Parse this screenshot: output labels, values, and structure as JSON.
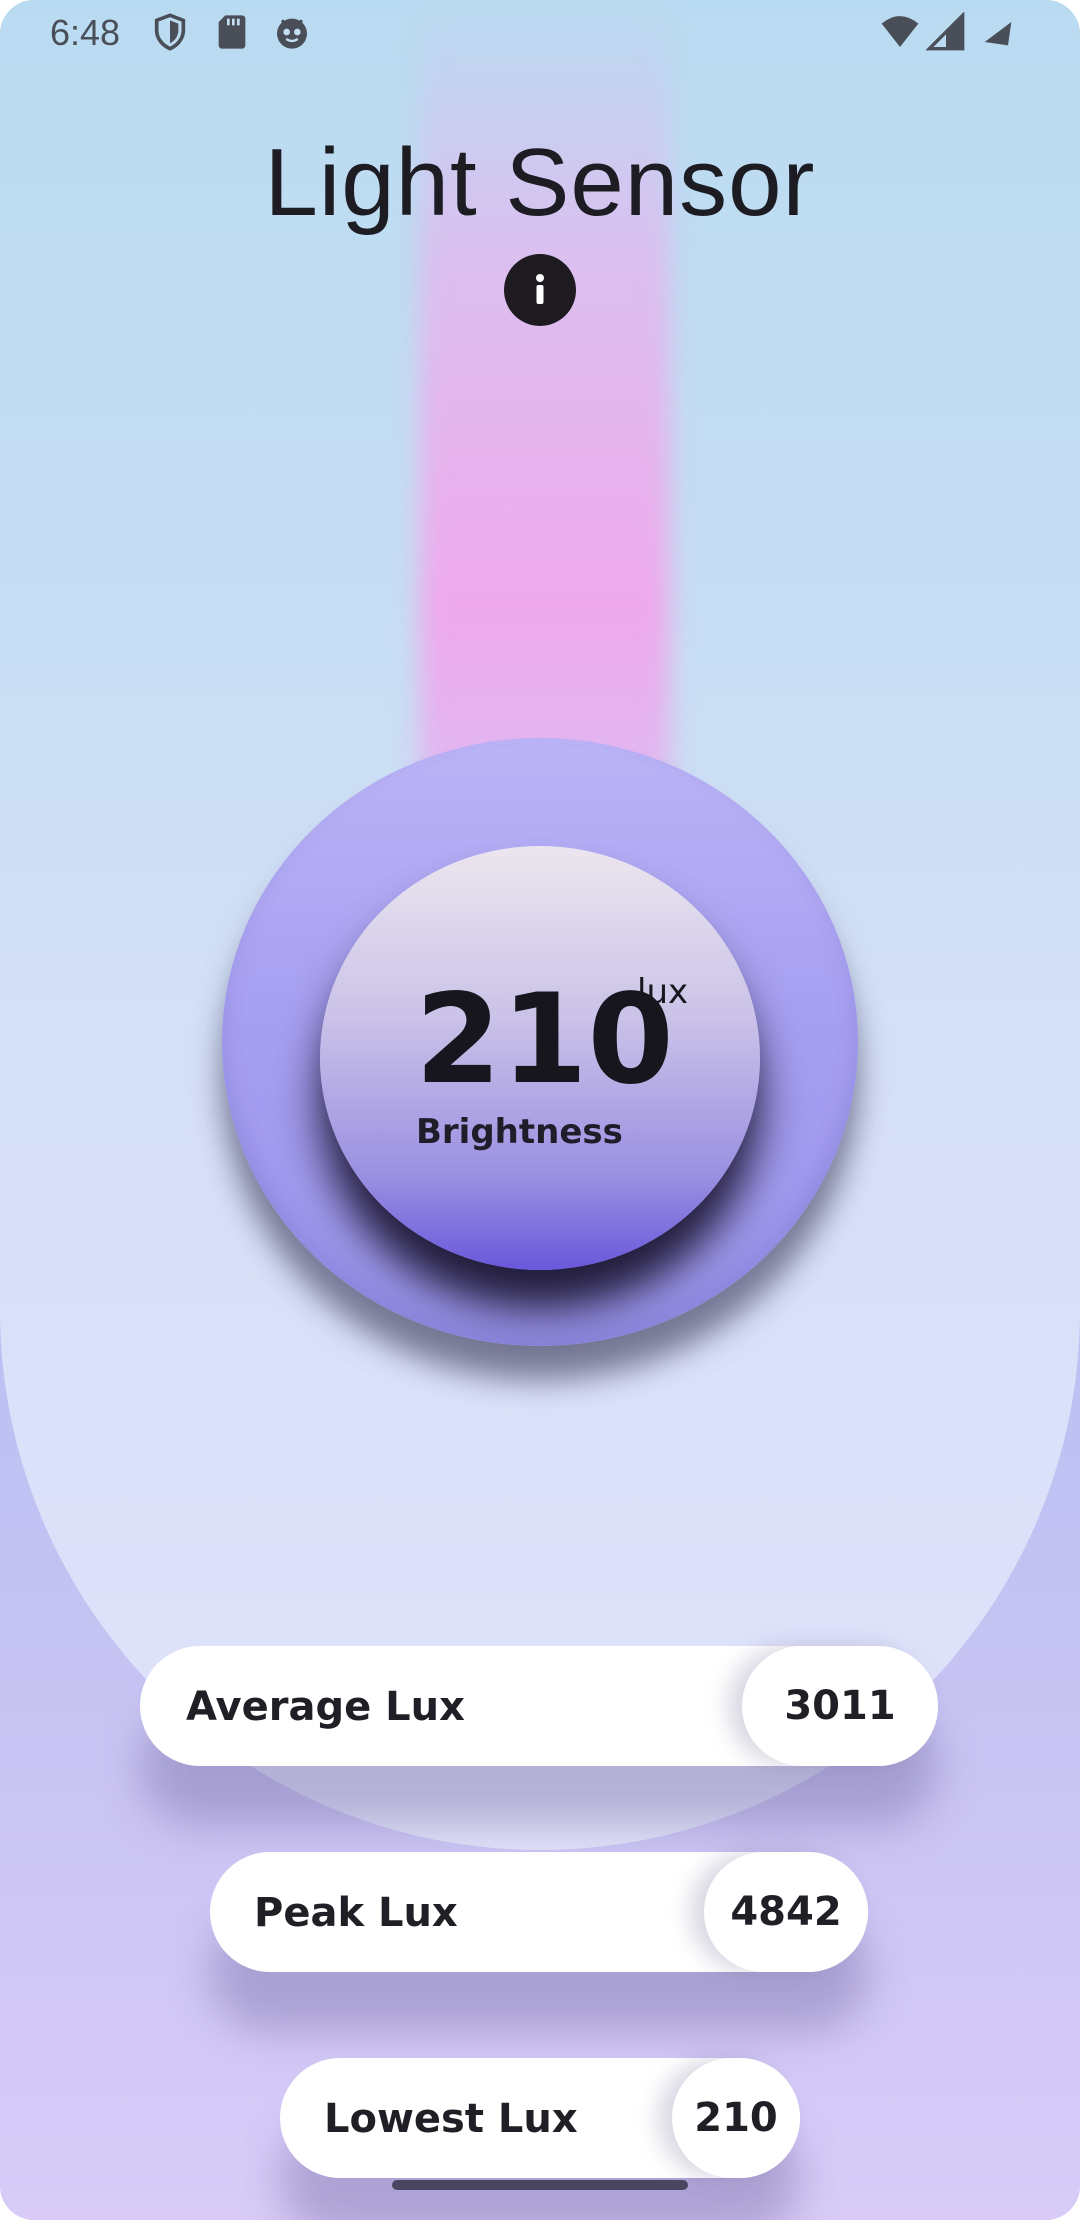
{
  "status_bar": {
    "time": "6:48",
    "left_icons": [
      "shield-icon",
      "sd-card-icon",
      "robot-face-icon"
    ],
    "right_icons": [
      "wifi-icon",
      "cell-signal-icon",
      "battery-icon"
    ]
  },
  "header": {
    "title": "Light Sensor",
    "info_icon": "info-icon"
  },
  "reading": {
    "value": "210",
    "unit": "lux",
    "label": "Brightness"
  },
  "stats": {
    "average": {
      "label": "Average Lux",
      "value": "3011"
    },
    "peak": {
      "label": "Peak Lux",
      "value": "4842"
    },
    "lowest": {
      "label": "Lowest Lux",
      "value": "210"
    }
  },
  "colors": {
    "accent": "#6a58dc",
    "beam": "#f1a6ec",
    "text": "#1c1c22"
  }
}
